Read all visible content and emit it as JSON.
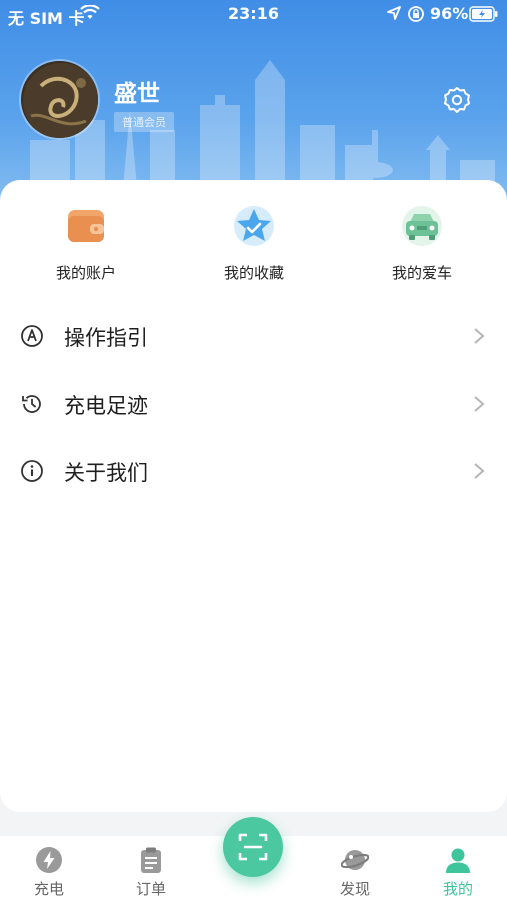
{
  "status_bar": {
    "carrier": "无 SIM 卡",
    "time": "23:16",
    "battery_percent": "96%"
  },
  "profile": {
    "username": "盛世",
    "member_level": "普通会员"
  },
  "shortcuts": [
    {
      "label": "我的账户",
      "icon": "wallet-icon"
    },
    {
      "label": "我的收藏",
      "icon": "star-icon"
    },
    {
      "label": "我的爱车",
      "icon": "car-icon"
    }
  ],
  "menu": [
    {
      "label": "操作指引",
      "icon": "guide-icon"
    },
    {
      "label": "充电足迹",
      "icon": "history-icon"
    },
    {
      "label": "关于我们",
      "icon": "info-icon"
    }
  ],
  "tabbar": {
    "items": [
      {
        "label": "充电",
        "icon": "lightning-icon"
      },
      {
        "label": "订单",
        "icon": "clipboard-icon"
      },
      {
        "label": "发现",
        "icon": "planet-icon"
      },
      {
        "label": "我的",
        "icon": "user-icon"
      }
    ],
    "active_index": 3
  },
  "colors": {
    "header_blue": "#3f8de6",
    "accent_green": "#3ec59b",
    "wallet_orange": "#e98f4f",
    "star_blue": "#4aa7ee",
    "car_green": "#6cc196"
  }
}
